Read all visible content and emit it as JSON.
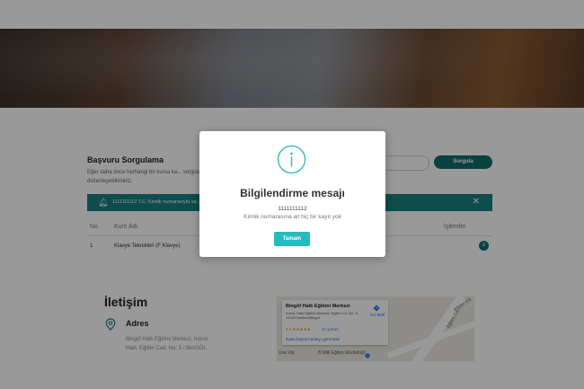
{
  "sorgulama": {
    "title": "Başvuru Sorgulama",
    "description": "Eğer daha önce herhangi bir kursa ka... sorgulayabilir veya düzenleyebilirsiniz.",
    "search_button": "Sorgula"
  },
  "alert": {
    "text": "1111111112 T.C. Kimlik numarasıyla sa...",
    "close_icon": "close-icon"
  },
  "table": {
    "headers": {
      "no": "No",
      "kurs_adi": "Kurs Adı",
      "islemler": "İşlemler"
    },
    "rows": [
      {
        "no": "1",
        "kurs_adi": "Klavye Teknikleri (F Klavye)",
        "action": "≡"
      }
    ]
  },
  "contact": {
    "title": "İletişim",
    "adres_label": "Adres",
    "adres_text": "Bingöl Halk Eğitimi Merkezi, İnönü Mah. Eğitim Cad. No: 5 / Bin/GÖL"
  },
  "map": {
    "card_title": "Bingöl Halk Eğitimi Merkezi",
    "card_address": "İnönü, Halk Eğitimi Merkezi, Eğitim Cd. No: 5, 12000 Merkez/Bingöl",
    "rating": "4.3 ★★★★★",
    "reviews": "12 yorum",
    "larger_map": "Daha büyük haritayı görüntüle",
    "directions": "Yol Tarifi",
    "label_road1": "Eğitim Cd.",
    "label_road2": "Eğitim Cd.",
    "label_store": "Uva Vip",
    "label_center": "B Milli Eğitim Müdürlüğü"
  },
  "modal": {
    "title": "Bilgilendirme mesajı",
    "number": "1111111112",
    "message": "Kimlik numarasına ait hiç bir kayıt yok",
    "ok_button": "Tamam",
    "icon": "info-icon"
  },
  "colors": {
    "teal_dark": "#0f6d6d",
    "teal_alert": "#16807e",
    "modal_button": "#26bcbf",
    "info_icon": "#2ab4c0"
  }
}
